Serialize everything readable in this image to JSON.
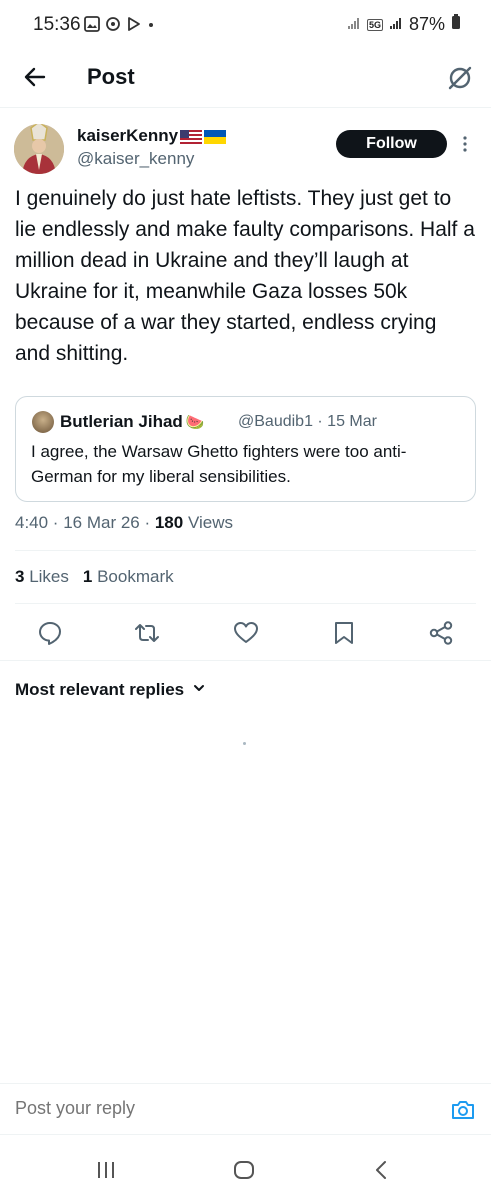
{
  "status_bar": {
    "time": "15:36",
    "network": "5G",
    "battery": "87%",
    "left_icons": [
      "image-icon",
      "sync-icon",
      "play-store-icon",
      "dot-icon"
    ],
    "right_icons": [
      "signal-icon",
      "network-5g-icon",
      "signal-icon",
      "battery-icon"
    ]
  },
  "header": {
    "title": "Post",
    "back_icon": "arrow-left-icon",
    "grok_icon": "grok-icon"
  },
  "post": {
    "author_name": "kaiserKenny",
    "author_flags": [
      "us-flag",
      "ukraine-flag"
    ],
    "author_handle": "@kaiser_kenny",
    "follow_label": "Follow",
    "text": "I genuinely do just hate leftists. They just get to lie endlessly and make faulty comparisons. Half a million dead in Ukraine and they’ll laugh at Ukraine for it, meanwhile Gaza losses 50k because of a war they started, endless crying and shitting.",
    "time": "4:40 · 16 Mar 26 · ",
    "views_count": "180",
    "views_label": " Views",
    "likes_count": "3",
    "likes_label": " Likes",
    "bookmarks_count": "1",
    "bookmarks_label": " Bookmark"
  },
  "quote": {
    "author_name": "Butlerian Jihad",
    "author_emoji": "🍉",
    "meta": "@Baudib1 · 15 Mar",
    "text": "I agree, the Warsaw Ghetto fighters were too anti-German for my liberal sensibilities."
  },
  "actions": [
    "reply-icon",
    "retweet-icon",
    "like-icon",
    "bookmark-icon",
    "share-icon"
  ],
  "replies": {
    "filter_label": "Most relevant replies"
  },
  "reply_bar": {
    "placeholder": "Post your reply"
  },
  "colors": {
    "text": "#0f1419",
    "secondary": "#536471",
    "accent": "#1d9bf0",
    "border": "#cfd9de"
  }
}
